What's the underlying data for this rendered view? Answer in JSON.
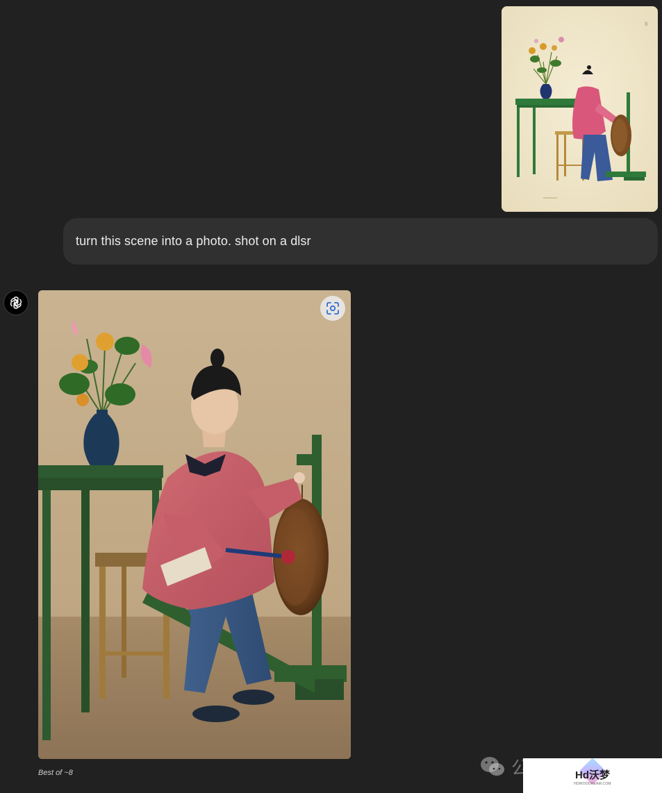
{
  "conversation": {
    "user_message": {
      "attachment": "uploaded-painting-image",
      "text": "turn this scene into a photo. shot on a dlsr"
    },
    "assistant_message": {
      "avatar_icon": "chatgpt-logo-icon",
      "image": "generated-photo-image",
      "action_icon": "select-region-icon",
      "caption": "Best of ~8"
    }
  },
  "watermark": {
    "icon": "wechat-icon",
    "text": "公",
    "logo_text": "Hd沃梦",
    "logo_subtext": "HDWOODREAM.COM"
  },
  "colors": {
    "background": "#212121",
    "bubble": "#303030",
    "text": "#ececec"
  }
}
